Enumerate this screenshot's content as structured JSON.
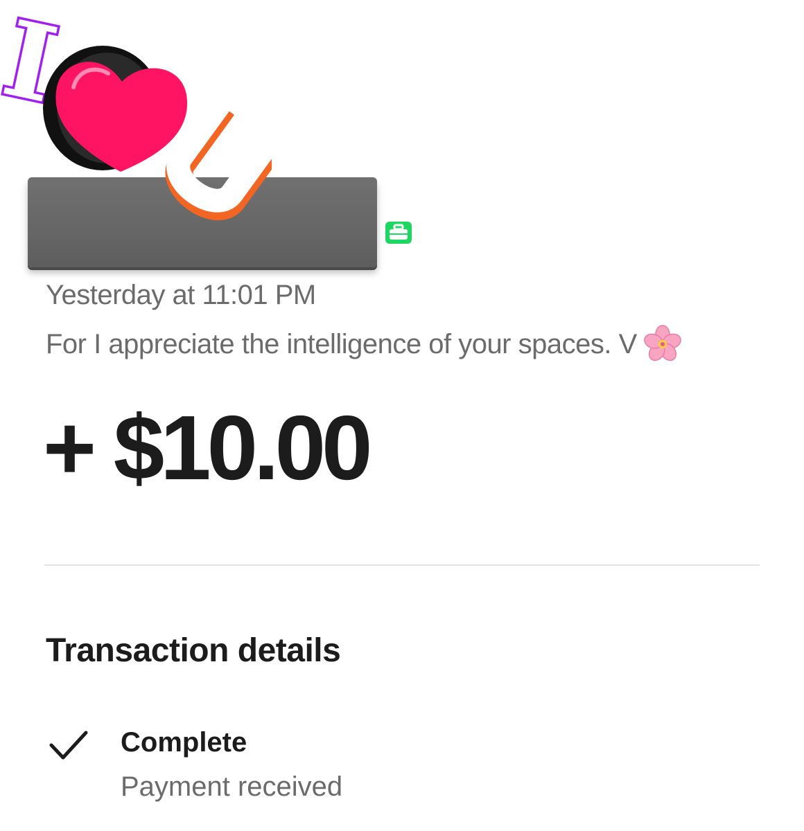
{
  "activity": {
    "timestamp": "Yesterday at 11:01 PM",
    "note": "For I appreciate the intelligence of your spaces. V",
    "note_emoji": "cherry-blossom-icon",
    "business_badge_icon": "briefcase-icon",
    "business_badge_color": "#1ed760"
  },
  "amount": {
    "display": "+ $10.00"
  },
  "details": {
    "title": "Transaction details",
    "status_icon": "check-icon",
    "status_title": "Complete",
    "status_subtitle": "Payment received"
  },
  "overlay": {
    "sticker_letters": "I",
    "sticker_u": "U",
    "heart_color": "#ff1464",
    "i_outline_color": "#a020f0",
    "u_outline_color": "#f26522"
  }
}
